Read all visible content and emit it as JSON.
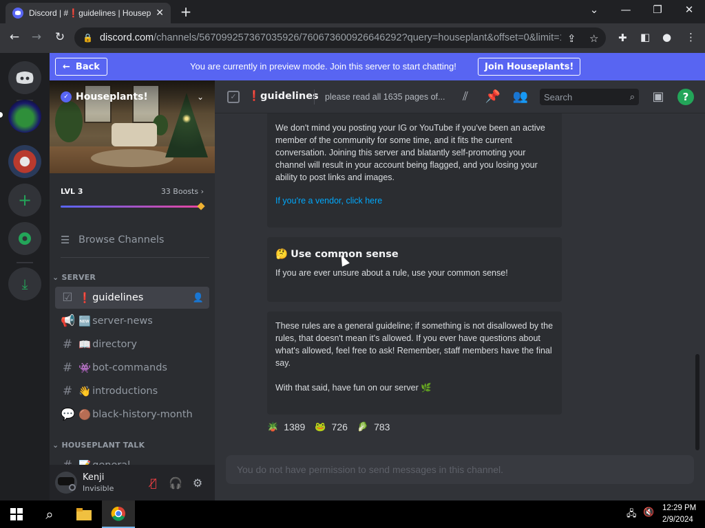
{
  "browser": {
    "tab_title": "Discord | #❗guidelines | Houseplants!",
    "url_host": "discord.com",
    "url_path": "/channels/567099257367035926/760673600926646292?query=houseplant&offset=0&limit=1..."
  },
  "banner": {
    "back_label": "Back",
    "message": "You are currently in preview mode. Join this server to start chatting!",
    "join_label": "Join Houseplants!"
  },
  "server": {
    "name": "Houseplants!",
    "level": "LVL 3",
    "boosts": "33 Boosts",
    "boost_progress": 1.0,
    "browse_label": "Browse Channels"
  },
  "categories": [
    {
      "label": "SERVER"
    },
    {
      "label": "HOUSEPLANT TALK"
    }
  ],
  "channels": [
    {
      "emoji": "❗",
      "name": "guidelines",
      "icon": "rules-icon",
      "active": true
    },
    {
      "emoji": "🆕",
      "name": "server-news",
      "icon": "megaphone-icon",
      "active": false
    },
    {
      "emoji": "📖",
      "name": "directory",
      "icon": "hash-icon",
      "active": false
    },
    {
      "emoji": "👾",
      "name": "bot-commands",
      "icon": "hash-icon",
      "active": false
    },
    {
      "emoji": "👋",
      "name": "introductions",
      "icon": "hash-icon",
      "active": false
    },
    {
      "emoji": "🟤",
      "name": "black-history-month",
      "icon": "forum-icon",
      "active": false
    },
    {
      "emoji": "📝",
      "name": "general",
      "icon": "hash-icon",
      "active": false
    }
  ],
  "user": {
    "name": "Kenji",
    "status": "Invisible"
  },
  "header": {
    "channel": "❗guidelines",
    "topic": "please read all 1635 pages of...",
    "search_placeholder": "Search"
  },
  "messages": {
    "self_promo_text": "We don't mind you posting your IG or YouTube if you've been an active member of the community for some time, and it fits the current conversation. Joining this server and blatantly self-promoting your channel will result in your account being flagged, and you losing your ability to post links and images.",
    "vendor_link": "If you're a vendor, click here",
    "common_sense_emoji": "🤔",
    "common_sense_title": "Use common sense",
    "common_sense_text": "If you are ever unsure about a rule, use your common sense!",
    "final_text_1": "These rules are a general guideline; if something is not disallowed by the rules, that doesn't mean it's allowed. If you ever have questions about what's allowed, feel free to ask! Remember, staff members have the final say.",
    "final_text_2": "With that said, have fun on our server 🌿"
  },
  "reactions": [
    {
      "emoji": "🪴",
      "count": "1389"
    },
    {
      "emoji": "🐸",
      "count": "726"
    },
    {
      "emoji": "🥬",
      "count": "783"
    }
  ],
  "composer": {
    "placeholder": "You do not have permission to send messages in this channel."
  },
  "taskbar": {
    "time": "12:29 PM",
    "date": "2/9/2024"
  },
  "colors": {
    "blurple": "#5865f2",
    "link": "#00a8fc",
    "help_green": "#23a559"
  }
}
